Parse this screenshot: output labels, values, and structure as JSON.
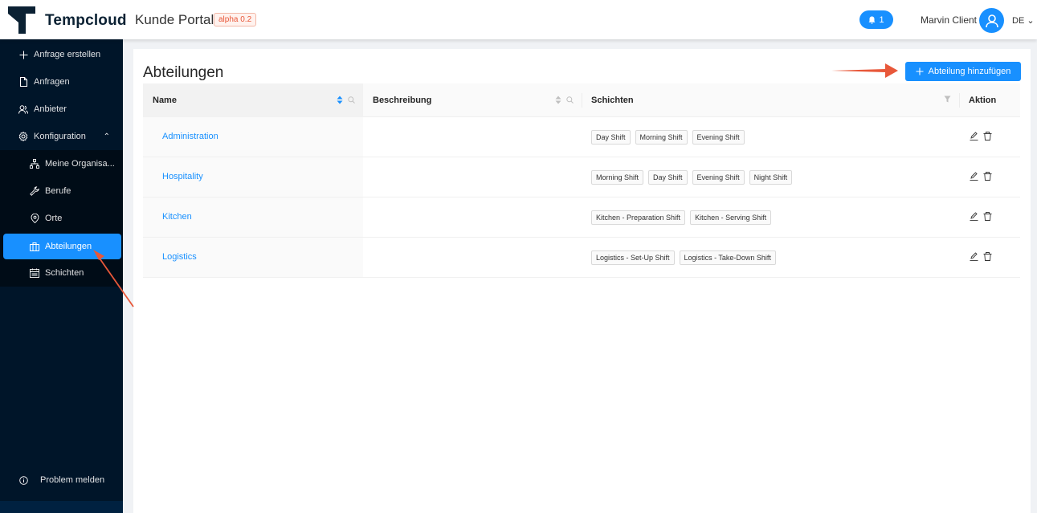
{
  "header": {
    "brand": "Tempcloud",
    "portal": "Kunde Portal",
    "badge": "alpha 0.2",
    "notification_count": "1",
    "user_name": "Marvin Client",
    "language": "DE"
  },
  "sidebar": {
    "items": [
      {
        "label": "Anfrage erstellen",
        "icon": "plus-icon"
      },
      {
        "label": "Anfragen",
        "icon": "document-icon"
      },
      {
        "label": "Anbieter",
        "icon": "users-icon"
      },
      {
        "label": "Konfiguration",
        "icon": "gear-icon"
      }
    ],
    "sub_items": [
      {
        "label": "Meine Organisa...",
        "icon": "org-icon"
      },
      {
        "label": "Berufe",
        "icon": "tool-icon"
      },
      {
        "label": "Orte",
        "icon": "location-icon"
      },
      {
        "label": "Abteilungen",
        "icon": "briefcase-icon",
        "active": true
      },
      {
        "label": "Schichten",
        "icon": "calendar-icon"
      }
    ],
    "footer": {
      "label": "Problem melden",
      "icon": "info-icon"
    }
  },
  "page": {
    "title": "Abteilungen",
    "add_button": "Abteilung hinzufügen"
  },
  "table": {
    "columns": [
      "Name",
      "Beschreibung",
      "Schichten",
      "Aktion"
    ],
    "rows": [
      {
        "name": "Administration",
        "description": "",
        "shifts": [
          "Day Shift",
          "Morning Shift",
          "Evening Shift"
        ]
      },
      {
        "name": "Hospitality",
        "description": "",
        "shifts": [
          "Morning Shift",
          "Day Shift",
          "Evening Shift",
          "Night Shift"
        ]
      },
      {
        "name": "Kitchen",
        "description": "",
        "shifts": [
          "Kitchen - Preparation Shift",
          "Kitchen - Serving Shift"
        ]
      },
      {
        "name": "Logistics",
        "description": "",
        "shifts": [
          "Logistics - Set-Up Shift",
          "Logistics - Take-Down Shift"
        ]
      }
    ]
  },
  "colors": {
    "primary": "#1890ff",
    "sidebar": "#001529",
    "annotation": "#e8583a"
  }
}
